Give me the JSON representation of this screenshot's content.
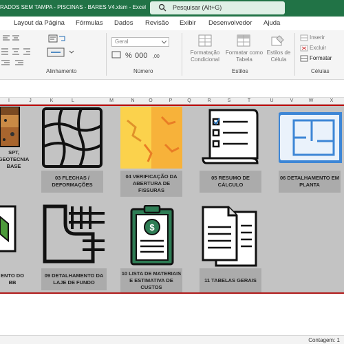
{
  "window": {
    "title": "RADOS SEM TAMPA - PISCINAS - BARES V4.xlsm  -  Excel",
    "search_placeholder": "Pesquisar (Alt+G)"
  },
  "ribbon_tabs": [
    "Layout da Página",
    "Fórmulas",
    "Dados",
    "Revisão",
    "Exibir",
    "Desenvolvedor",
    "Ajuda"
  ],
  "ribbon": {
    "number_format": "Geral",
    "groups": {
      "alignment": "Alinhamento",
      "number": "Número",
      "styles": "Estilos",
      "cells": "Células"
    },
    "styles": {
      "conditional_format": "Formatação\nCondicional",
      "format_as_table": "Formatar como\nTabela",
      "cell_styles": "Estilos de\nCélula"
    },
    "cells": {
      "insert": "Inserir",
      "delete": "Excluir",
      "format": "Formatar"
    }
  },
  "columns": [
    "I",
    "J",
    "K",
    "L",
    "M",
    "N",
    "O",
    "P",
    "Q",
    "R",
    "S",
    "T",
    "U",
    "V",
    "W",
    "X"
  ],
  "tiles": [
    {
      "label": "SPT,\nGEOTECNIA\nBASE",
      "icon": "soil-layers-icon"
    },
    {
      "label": "03 FLECHAS /\nDEFORMAÇÕES",
      "icon": "deformation-grid-icon"
    },
    {
      "label": "04 VERIFICAÇÃO DA\nABERTURA DE\nFISSURAS",
      "icon": "cracked-wall-icon"
    },
    {
      "label": "05 RESUMO DE\nCÁLCULO",
      "icon": "checklist-icon"
    },
    {
      "label": "06 DETALHAMENTO EM\nPLANTA",
      "icon": "floor-plan-icon"
    },
    {
      "label": "ENTO DO\nBB",
      "icon": "box-3d-icon"
    },
    {
      "label": "09 DETALHAMENTO DA\nLAJE DE FUNDO",
      "icon": "rebar-slab-icon"
    },
    {
      "label": "10 LISTA DE MATERIAIS\nE ESTIMATIVA DE\nCUSTOS",
      "icon": "clipboard-dollar-icon"
    },
    {
      "label": "11 TABELAS GERAIS",
      "icon": "documents-icon"
    }
  ],
  "status": {
    "count_text": "Contagem: 1"
  },
  "colors": {
    "excel_green": "#217346",
    "panel_grey": "#c3c3c3",
    "label_grey": "#ababab",
    "accent_red": "#c00000"
  }
}
